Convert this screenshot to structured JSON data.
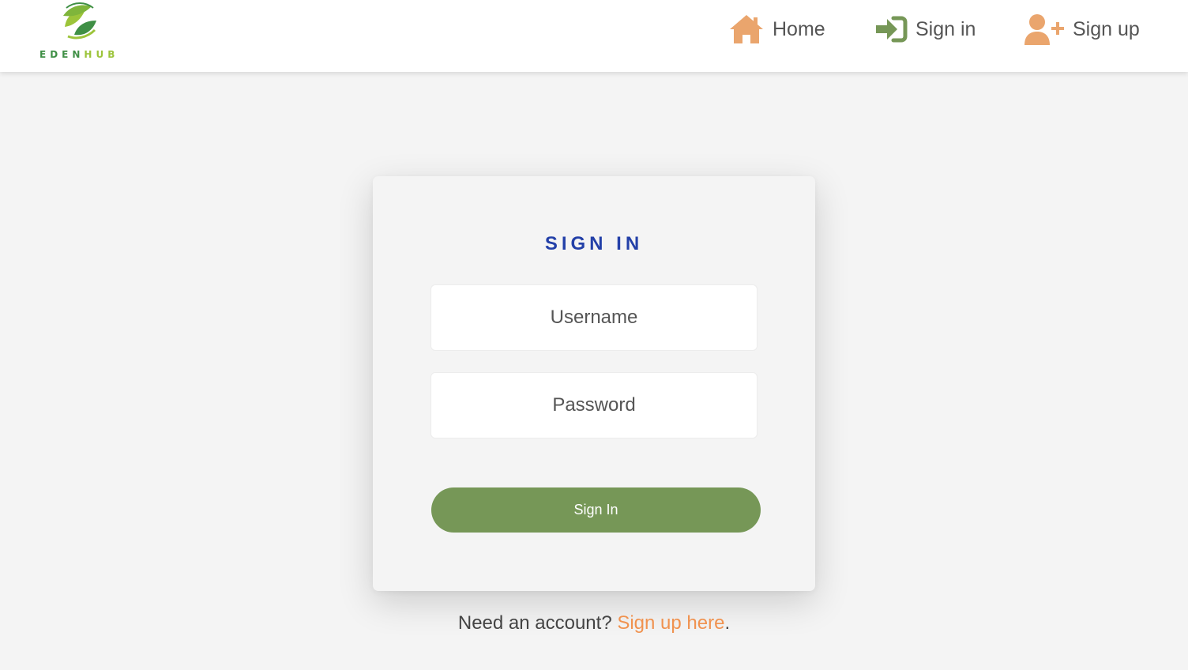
{
  "brand": {
    "part1": "EDEN",
    "part2": "HUB",
    "color_primary": "#3f8f45",
    "color_secondary": "#9cc43a"
  },
  "nav": {
    "items": [
      {
        "label": "Home",
        "icon": "home-icon",
        "icon_color": "#eaa56d"
      },
      {
        "label": "Sign in",
        "icon": "sign-in-icon",
        "icon_color": "#769757"
      },
      {
        "label": "Sign up",
        "icon": "user-plus-icon",
        "icon_color": "#eaa56d"
      }
    ]
  },
  "signin_form": {
    "title": "SIGN IN",
    "username_placeholder": "Username",
    "password_placeholder": "Password",
    "submit_label": "Sign In",
    "title_color": "#2340a8",
    "button_color": "#769757"
  },
  "footer": {
    "prompt": "Need an account?",
    "link_label": "Sign up here",
    "suffix": ".",
    "link_color": "#f0924f"
  }
}
